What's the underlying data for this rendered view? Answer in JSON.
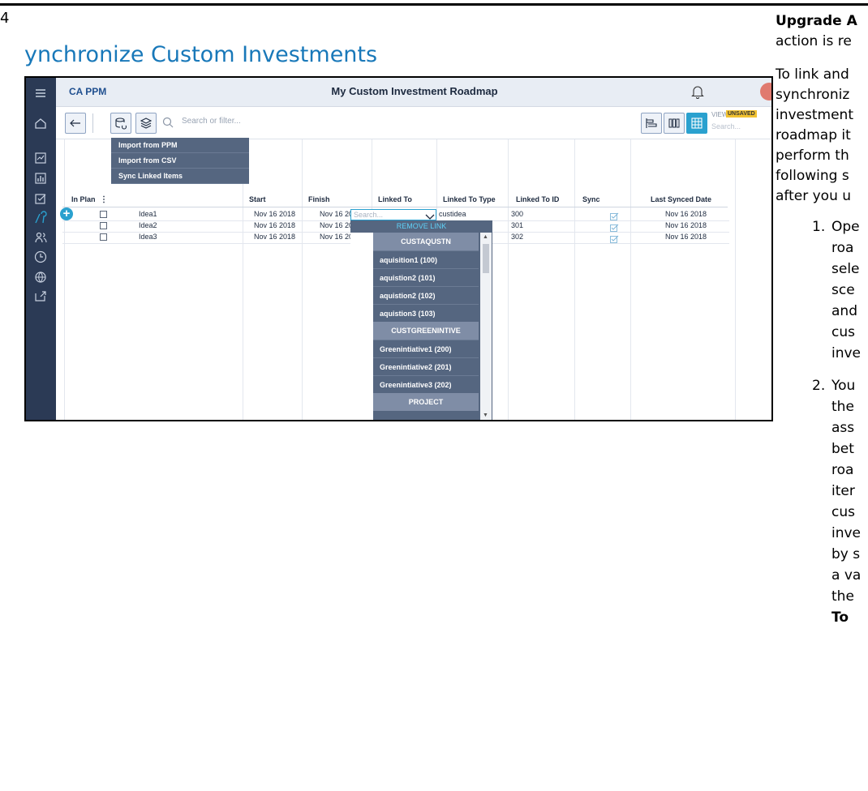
{
  "page": {
    "number": "4",
    "title": "ynchronize Custom Investments",
    "side_text": {
      "heading": "Upgrade A",
      "line1": "action is re",
      "para": [
        "To link and",
        "synchroniz",
        "investment",
        "roadmap it",
        "perform th",
        "following s",
        "after you u"
      ],
      "item1_num": "1.",
      "item1": [
        "Ope",
        "roa",
        "sele",
        "sce",
        "and",
        "cus",
        "inve"
      ],
      "item2_num": "2.",
      "item2": [
        "You",
        "the",
        "ass",
        "bet",
        "roa",
        "iter",
        "cus",
        "inve",
        "by s",
        "a va",
        "the"
      ],
      "item2_last": "To "
    }
  },
  "app": {
    "name": "CA PPM",
    "title": "My Custom Investment Roadmap",
    "search_placeholder": "Search or filter...",
    "view_label": "VIEW",
    "view_badge": "UNSAVED",
    "view_search": "Search..."
  },
  "import_menu": [
    "Import from PPM",
    "Import from CSV",
    "Sync Linked Items"
  ],
  "table": {
    "columns": {
      "in_plan": "In Plan",
      "start": "Start",
      "finish": "Finish",
      "linked_to": "Linked To",
      "linked_to_type": "Linked To Type",
      "linked_to_id": "Linked To ID",
      "sync": "Sync",
      "last_synced": "Last Synced Date"
    },
    "rows": [
      {
        "name": "Idea1",
        "start": "Nov 16 2018",
        "finish": "Nov 16 2018",
        "linked_type": "custidea",
        "linked_id": "300",
        "last_synced": "Nov 16 2018"
      },
      {
        "name": "Idea2",
        "start": "Nov 16 2018",
        "finish": "Nov 16 2018",
        "linked_type": "",
        "linked_id": "301",
        "last_synced": "Nov 16 2018"
      },
      {
        "name": "Idea3",
        "start": "Nov 16 2018",
        "finish": "Nov 16 2018",
        "linked_type": "",
        "linked_id": "302",
        "last_synced": "Nov 16 2018"
      }
    ],
    "linked_search_placeholder": "Search..."
  },
  "dropdown": {
    "remove": "REMOVE LINK",
    "groups": [
      {
        "label": "CUSTAQUSTN",
        "options": [
          "aquisition1 (100)",
          "aquistion2 (101)",
          "aquistion2 (102)",
          "aquistion3 (103)"
        ]
      },
      {
        "label": "CUSTGREENINTIVE",
        "options": [
          "Greenintiative1 (200)",
          "Greenintiative2 (201)",
          "Greenintiative3 (202)"
        ]
      },
      {
        "label": "PROJECT",
        "options": []
      }
    ]
  },
  "colors": {
    "accent": "#2aa1cf",
    "nav": "#2b3a55",
    "menu": "#556680",
    "title_blue": "#1878b9"
  }
}
